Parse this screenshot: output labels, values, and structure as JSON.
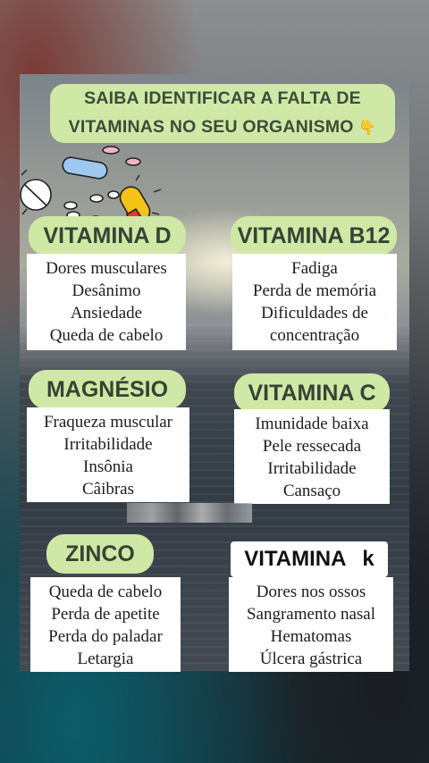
{
  "title": {
    "line1": "SAIBA IDENTIFICAR A FALTA DE",
    "line2": "VITAMINAS NO SEU ORGANISMO",
    "emoji": "👇"
  },
  "sections": [
    {
      "label": "VITAMINA D",
      "items": [
        "Dores musculares",
        "Desânimo",
        "Ansiedade",
        "Queda de cabelo"
      ]
    },
    {
      "label": "VITAMINA B12",
      "items": [
        "Fadiga",
        "Perda de memória",
        "Dificuldades de",
        "concentração"
      ]
    },
    {
      "label": "MAGNÉSIO",
      "items": [
        "Fraqueza muscular",
        "Irritabilidade",
        "Insônia",
        "Câibras"
      ]
    },
    {
      "label": "VITAMINA C",
      "items": [
        "Imunidade baixa",
        "Pele ressecada",
        "Irritabilidade",
        "Cansaço"
      ]
    },
    {
      "label": "ZINCO",
      "items": [
        "Queda de cabelo",
        "Perda de apetite",
        "Perda do paladar",
        "Letargia"
      ]
    },
    {
      "label": "VITAMINA",
      "label_suffix": "k",
      "items": [
        "Dores nos ossos",
        "Sangramento nasal",
        "Hematomas",
        "Úlcera gástrica"
      ]
    }
  ],
  "colors": {
    "label_bg": "#cfe8a6",
    "label_text": "#364335",
    "box_bg": "#ffffff"
  },
  "icons": [
    "pills-illustration",
    "pointing-down-emoji"
  ]
}
